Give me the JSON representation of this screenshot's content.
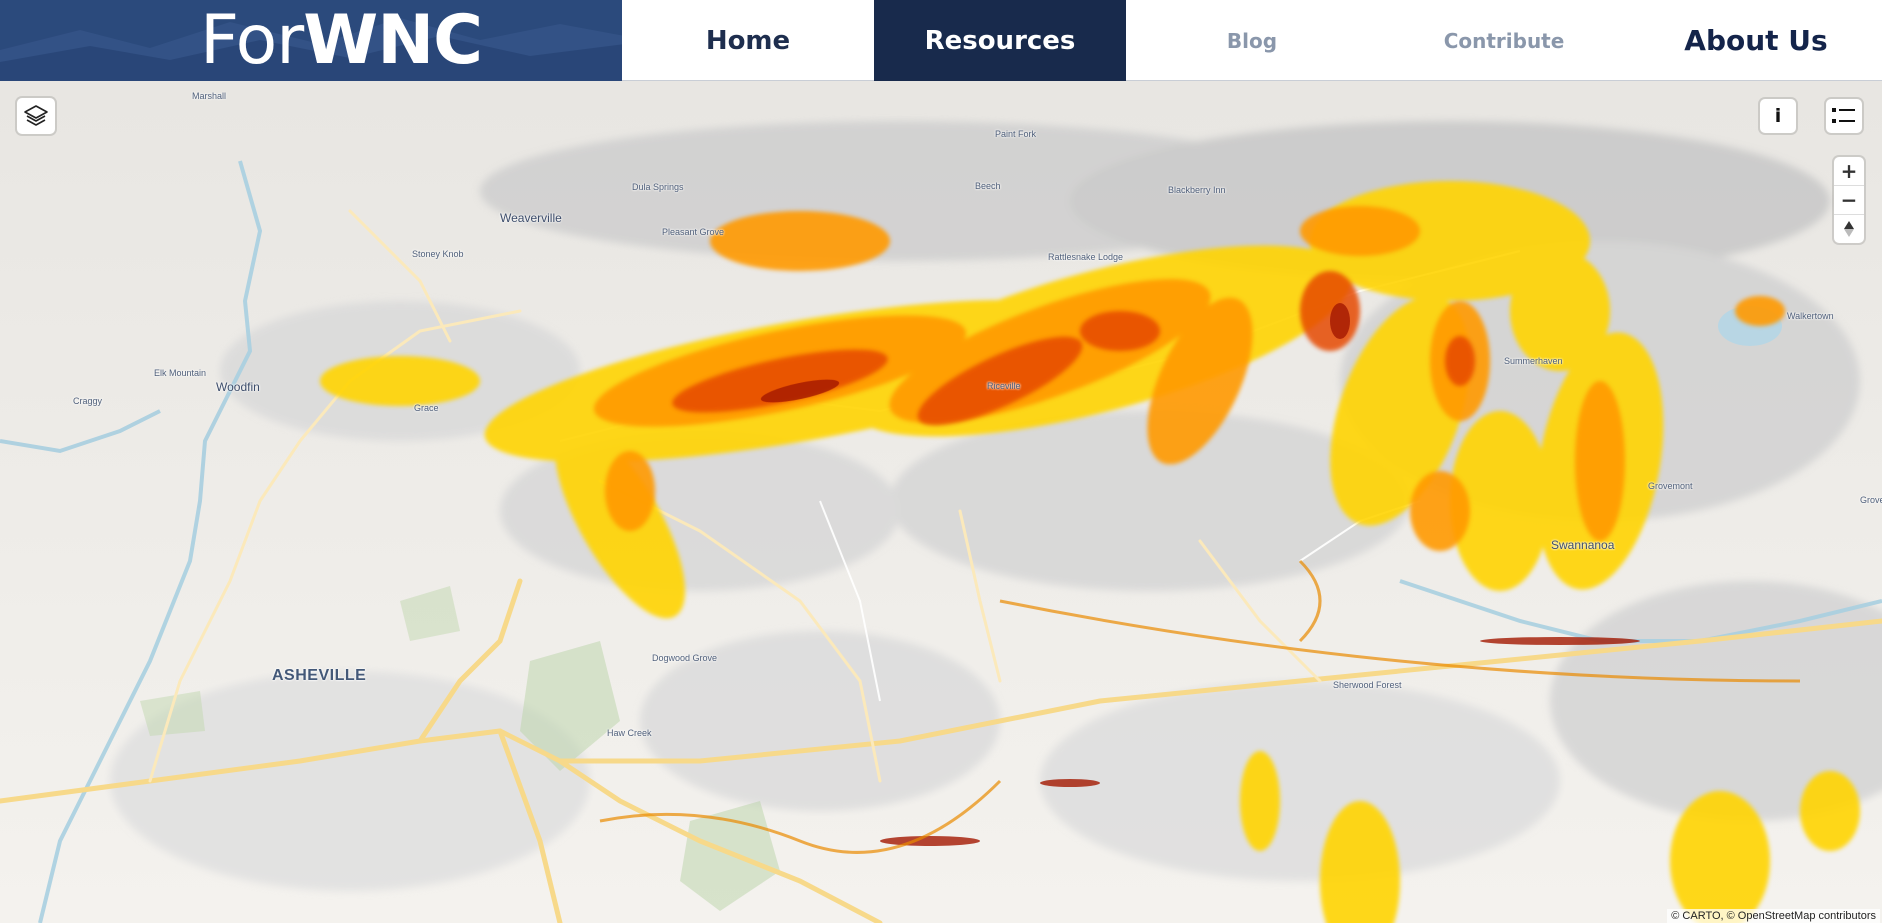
{
  "header": {
    "logo_part1": "For",
    "logo_part2": "WNC",
    "nav": [
      {
        "label": "Home"
      },
      {
        "label": "Resources"
      },
      {
        "label": "Blog"
      },
      {
        "label": "Contribute"
      },
      {
        "label": "About Us"
      }
    ]
  },
  "map": {
    "places": [
      {
        "name": "Marshall",
        "kind": "village"
      },
      {
        "name": "Weaverville",
        "kind": "town"
      },
      {
        "name": "Dula Springs",
        "kind": "village"
      },
      {
        "name": "Pleasant Grove",
        "kind": "village"
      },
      {
        "name": "Stoney Knob",
        "kind": "village"
      },
      {
        "name": "Beech",
        "kind": "village"
      },
      {
        "name": "Paint Fork",
        "kind": "village"
      },
      {
        "name": "Blackberry Inn",
        "kind": "village"
      },
      {
        "name": "Rattlesnake Lodge",
        "kind": "village"
      },
      {
        "name": "Elk Mountain",
        "kind": "village"
      },
      {
        "name": "Woodfin",
        "kind": "town"
      },
      {
        "name": "Craggy",
        "kind": "village"
      },
      {
        "name": "Grace",
        "kind": "village"
      },
      {
        "name": "Riceville",
        "kind": "village"
      },
      {
        "name": "Summerhaven",
        "kind": "village"
      },
      {
        "name": "Walkertown",
        "kind": "village"
      },
      {
        "name": "Grovemont",
        "kind": "village"
      },
      {
        "name": "Swannanoa",
        "kind": "town"
      },
      {
        "name": "Grove",
        "kind": "village"
      },
      {
        "name": "ASHEVILLE",
        "kind": "city"
      },
      {
        "name": "Dogwood Grove",
        "kind": "village"
      },
      {
        "name": "Sherwood Forest",
        "kind": "village"
      },
      {
        "name": "Haw Creek",
        "kind": "village"
      }
    ],
    "controls": {
      "layers_icon": "layers-icon",
      "info_label": "i",
      "legend_icon": "legend-list-icon",
      "zoom_in": "+",
      "zoom_out": "−",
      "compass_icon": "compass-arrow-icon"
    },
    "attribution": "© CARTO, © OpenStreetMap contributors",
    "colors": {
      "hazard_low": "#ffd400",
      "hazard_mid": "#ff9a00",
      "hazard_high": "#e64a00",
      "hazard_extreme": "#a31800",
      "brand": "#2b4a7c",
      "nav_active": "#182a4c"
    }
  }
}
